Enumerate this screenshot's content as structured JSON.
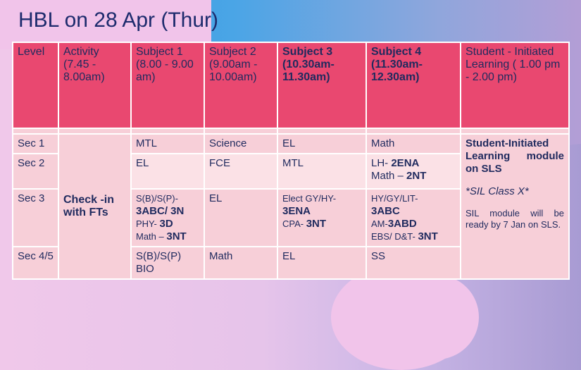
{
  "title": "HBL on 28 Apr (Thur)",
  "headers": {
    "level": "Level",
    "activity": "Activity (7.45 - 8.00am)",
    "subject1": "Subject 1 (8.00 - 9.00 am)",
    "subject2": "Subject 2 (9.00am - 10.00am)",
    "subject3": "Subject 3 (10.30am- 11.30am)",
    "subject4": "Subject 4 (11.30am- 12.30am)",
    "sil": "Student - Initiated Learning ( 1.00 pm - 2.00 pm)"
  },
  "activity_text": "Check -in with FTs",
  "sil_cell": {
    "title": "Student-Initiated Learning module on SLS",
    "class_note": "*SIL Class X*",
    "note": "SIL module will be ready by 7 Jan on SLS."
  },
  "rows": {
    "sec1": {
      "level": "Sec 1",
      "s1": "MTL",
      "s2": "Science",
      "s3": "EL",
      "s4": "Math"
    },
    "sec2": {
      "level": "Sec 2",
      "s1": "EL",
      "s2": "FCE",
      "s3": "MTL",
      "s4_a_pre": "LH- ",
      "s4_a_bold": "2ENA",
      "s4_b_pre": "Math – ",
      "s4_b_bold": "2NT"
    },
    "sec3": {
      "level": "Sec 3",
      "s1_a": "S(B)/S(P)-",
      "s1_b_bold": "3ABC/ 3N",
      "s1_c_pre": "PHY- ",
      "s1_c_bold": "3D",
      "s1_d_pre": "Math – ",
      "s1_d_bold": "3NT",
      "s2": "EL",
      "s3_a": "Elect GY/HY-",
      "s3_b_bold": "3ENA",
      "s3_c_pre": "CPA- ",
      "s3_c_bold": "3NT",
      "s4_a": "HY/GY/LIT-",
      "s4_b_bold": "3ABC",
      "s4_c_pre": "AM-",
      "s4_c_bold": "3ABD",
      "s4_d_pre": "EBS/ D&T- ",
      "s4_d_bold": "3NT"
    },
    "sec45": {
      "level": "Sec 4/5",
      "s1": "S(B)/S(P) BIO",
      "s2": "Math",
      "s3": "EL",
      "s4": "SS"
    }
  },
  "colors": {
    "header_bg": "#e94870",
    "cell_bg": "#f7cfd8",
    "title": "#1d2b6d"
  }
}
